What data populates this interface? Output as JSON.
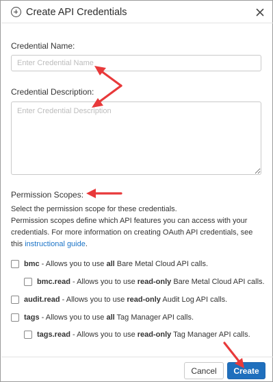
{
  "dialog": {
    "title": "Create API Credentials",
    "close_icon": "close-icon",
    "header_icon": "plus-circle-icon"
  },
  "credential_name": {
    "label": "Credential Name:",
    "placeholder": "Enter Credential Name",
    "value": ""
  },
  "credential_description": {
    "label": "Credential Description:",
    "placeholder": "Enter Credential Description",
    "value": ""
  },
  "permission": {
    "heading": "Permission Scopes:",
    "lines": [
      "Select the permission scope for these credentials.",
      "Permission scopes define which API features you can access with your",
      "credentials. For more information on creating OAuth API credentials, see"
    ],
    "line4_prefix": "this ",
    "link_text": "instructional guide",
    "line4_suffix": "."
  },
  "scopes": [
    {
      "name": "bmc",
      "pre": " - Allows you to use ",
      "em": "all",
      "post": " Bare Metal Cloud API calls.",
      "checked": false
    },
    {
      "name": "bmc.read",
      "pre": " - Allows you to use ",
      "em": "read-only",
      "post": " Bare Metal Cloud API calls.",
      "checked": false
    },
    {
      "name": "audit.read",
      "pre": " - Allows you to use ",
      "em": "read-only",
      "post": " Audit Log API calls.",
      "checked": false
    },
    {
      "name": "tags",
      "pre": " - Allows you to use ",
      "em": "all",
      "post": " Tag Manager API calls.",
      "checked": false
    },
    {
      "name": "tags.read",
      "pre": " - Allows you to use ",
      "em": "read-only",
      "post": " Tag Manager API calls.",
      "checked": false
    }
  ],
  "buttons": {
    "cancel": "Cancel",
    "create": "Create"
  },
  "colors": {
    "primary": "#1f6fbd",
    "link": "#1a73c7",
    "annotation_arrow": "#e8393a"
  }
}
